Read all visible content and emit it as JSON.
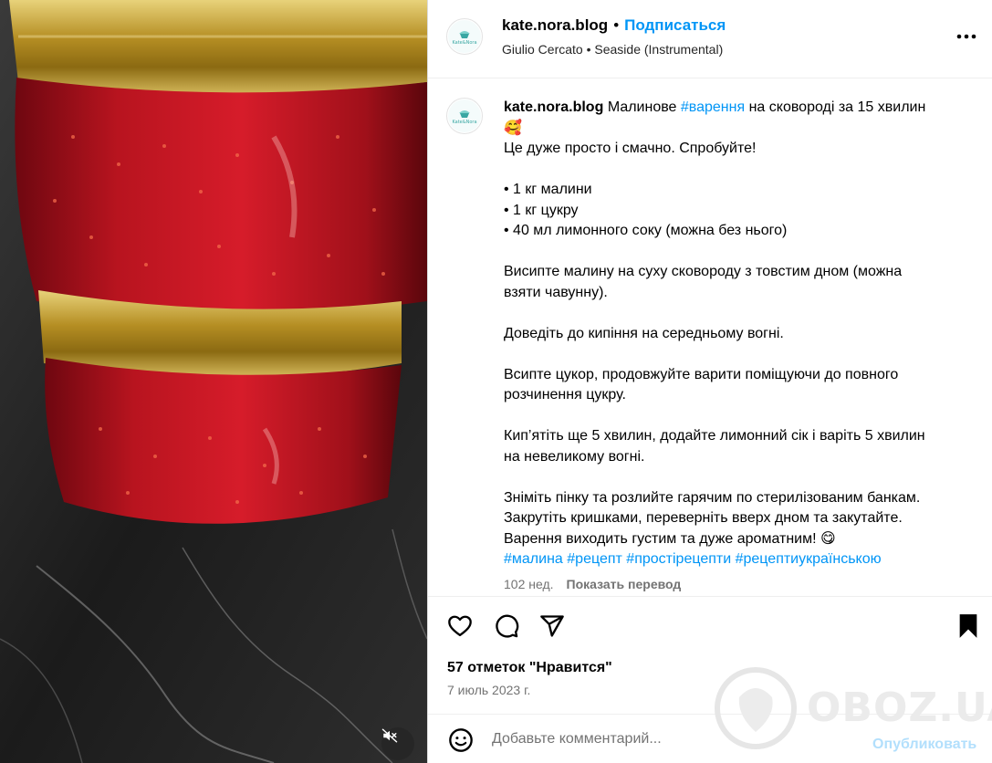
{
  "post": {
    "media": {
      "alt_icon": "mute-icon"
    },
    "header": {
      "username": "kate.nora.blog",
      "separator": "•",
      "follow_label": "Подписаться",
      "audio_artist": "Giulio Cercato",
      "audio_separator": "•",
      "audio_title": "Seaside (Instrumental)",
      "avatar_text": "Kate&Nora",
      "more_icon": "more-horizontal-icon"
    },
    "caption": {
      "username": "kate.nora.blog",
      "line1_text1": "Малинове ",
      "line1_tag": "#варення",
      "line1_text2": " на сковороді за 15 хвилин",
      "line2_emoji": "🥰",
      "line3": "Це дуже просто і смачно. Спробуйте!",
      "ingredients": [
        "• 1 кг малини",
        "• 1 кг цукру",
        "• 40 мл лимонного соку (можна без нього)"
      ],
      "step1_a": "Висипте малину на суху сковороду з товстим дном (можна",
      "step1_b": "взяти чавунну).",
      "step2": "Доведіть до кипіння на середньому вогні.",
      "step3_a": "Всипте цукор, продовжуйте варити поміщуючи до повного",
      "step3_b": "розчинення цукру.",
      "step4_a": "Кип’ятіть ще 5 хвилин, додайте лимонний сік і варіть 5 хвилин",
      "step4_b": "на невеликому вогні.",
      "step5_a": "Зніміть пінку та розлийте гарячим по стерилізованим банкам.",
      "step5_b": "Закрутіть кришками, переверніть вверх дном та закутайте.",
      "step5_c": "Варення виходить густим та дуже ароматним! ",
      "step5_emoji": "😋",
      "hashtags": [
        "#малина",
        "#рецепт",
        "#простірецепти",
        "#рецептиукраїнською"
      ]
    },
    "meta": {
      "age": "102 нед.",
      "translate_label": "Показать перевод"
    },
    "actions": {
      "like_icon": "heart-icon",
      "comment_icon": "comment-icon",
      "share_icon": "share-icon",
      "save_icon": "bookmark-icon"
    },
    "likes_text": "57 отметок \"Нравится\"",
    "date": "7 июль 2023 г.",
    "comment_box": {
      "emoji_icon": "emoji-icon",
      "placeholder": "Добавьте комментарий...",
      "publish_label": "Опубликовать"
    },
    "watermark": {
      "text": "OBOZ.UA"
    }
  }
}
